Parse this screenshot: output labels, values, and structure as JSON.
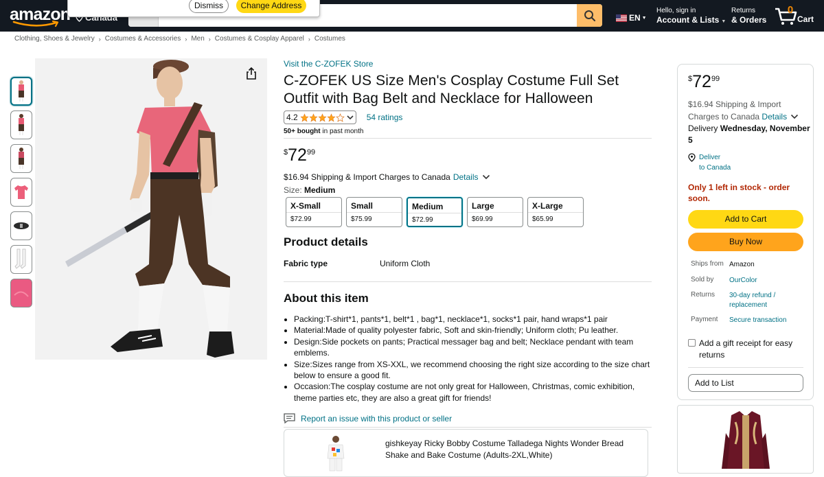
{
  "nav": {
    "logo": "amazon",
    "deliver_country": "Canada",
    "search": {
      "category": "All",
      "placeholder": ""
    },
    "popover": {
      "dismiss": "Dismiss",
      "change": "Change Address"
    },
    "lang": "EN",
    "account_line1": "Hello, sign in",
    "account_line2": "Account & Lists",
    "orders_line1": "Returns",
    "orders_line2": "& Orders",
    "cart_count": "0",
    "cart_label": "Cart"
  },
  "breadcrumb": [
    "Clothing, Shoes & Jewelry",
    "Costumes & Accessories",
    "Men",
    "Costumes & Cosplay Apparel",
    "Costumes"
  ],
  "product": {
    "store_link": "Visit the C-ZOFEK Store",
    "title": "C-ZOFEK US Size Men's Cosplay Costume Full Set Outfit with Bag Belt and Necklace for Halloween",
    "rating": "4.2",
    "rating_value": 4.2,
    "ratings_count": "54 ratings",
    "bought_bold": "50+ bought",
    "bought_rest": " in past month",
    "price_symbol": "$",
    "price_whole": "72",
    "price_fraction": "99",
    "shipping_text": "$16.94 Shipping & Import Charges to Canada",
    "details_link": "Details",
    "size_prefix": "Size: ",
    "size_selected": "Medium",
    "sizes": [
      {
        "name": "X-Small",
        "price": "$72.99"
      },
      {
        "name": "Small",
        "price": "$75.99"
      },
      {
        "name": "Medium",
        "price": "$72.99"
      },
      {
        "name": "Large",
        "price": "$69.99"
      },
      {
        "name": "X-Large",
        "price": "$65.99"
      }
    ],
    "details_heading": "Product details",
    "fabric_key": "Fabric type",
    "fabric_value": "Uniform Cloth",
    "about_heading": "About this item",
    "bullets": [
      "Packing:T-shirt*1, pants*1, belt*1 , bag*1, necklace*1, socks*1 pair, hand wraps*1 pair",
      "Material:Made of quality polyester fabric, Soft and skin-friendly; Uniform cloth; Pu leather.",
      "Design:Side pockets on pants; Practical messager bag and belt; Necklace pendant with team emblems.",
      "Size:Sizes range from XS-XXL, we recommend choosing the right size according to the size chart below to ensure a good fit.",
      "Occasion:The cosplay costume are not only great for Halloween, Christmas, comic exhibition, theme parties etc, they are also a great gift for friends!"
    ],
    "report_link": "Report an issue with this product or seller",
    "sponsored_title": "gishkeyay Ricky Bobby Costume Talladega Nights Wonder Bread Shake and Bake Costume (Adults-2XL,White)"
  },
  "buybox": {
    "price_symbol": "$",
    "price_whole": "72",
    "price_fraction": "99",
    "shipping_text": "$16.94 Shipping & Import Charges to Canada",
    "details_link": "Details",
    "delivery_prefix": "Delivery ",
    "delivery_date": "Wednesday, November 5",
    "deliver_to_1": "Deliver",
    "deliver_to_2": "to Canada",
    "stock": "Only 1 left in stock - order soon.",
    "add_to_cart": "Add to Cart",
    "buy_now": "Buy Now",
    "ships_from_k": "Ships from",
    "ships_from_v": "Amazon",
    "sold_by_k": "Sold by",
    "sold_by_v": "OurColor",
    "returns_k": "Returns",
    "returns_v": "30-day refund / replacement",
    "payment_k": "Payment",
    "payment_v": "Secure transaction",
    "gift": "Add a gift receipt for easy returns",
    "add_to_list": "Add to List"
  },
  "colors": {
    "nav_bg": "#131921",
    "link": "#007185",
    "cart_yellow": "#ffd814",
    "buy_orange": "#ffa41c",
    "stock_red": "#b12704",
    "star": "#ffa41c"
  },
  "icons": [
    "amazon-logo-smile",
    "location-pin-icon",
    "search-icon",
    "us-flag-icon",
    "cart-icon",
    "share-icon",
    "star-icon",
    "chevron-down-icon",
    "report-icon"
  ]
}
